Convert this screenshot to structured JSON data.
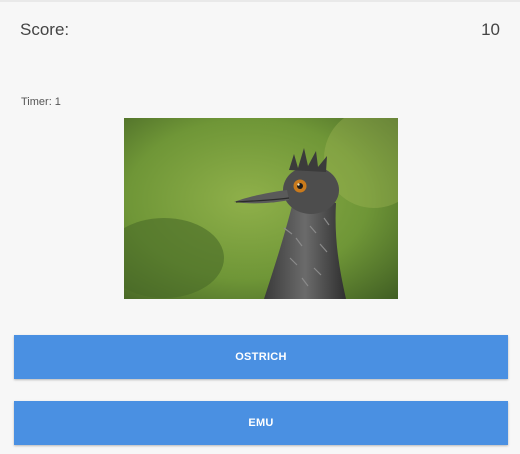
{
  "header": {
    "score_label": "Score:",
    "score_value": "10"
  },
  "timer": {
    "text": "Timer: 1"
  },
  "image": {
    "subject": "emu-photo"
  },
  "answers": [
    {
      "label": "OSTRICH"
    },
    {
      "label": "EMU"
    }
  ],
  "colors": {
    "background": "#f7f7f7",
    "button": "#4a90e2",
    "button_text": "#ffffff"
  }
}
